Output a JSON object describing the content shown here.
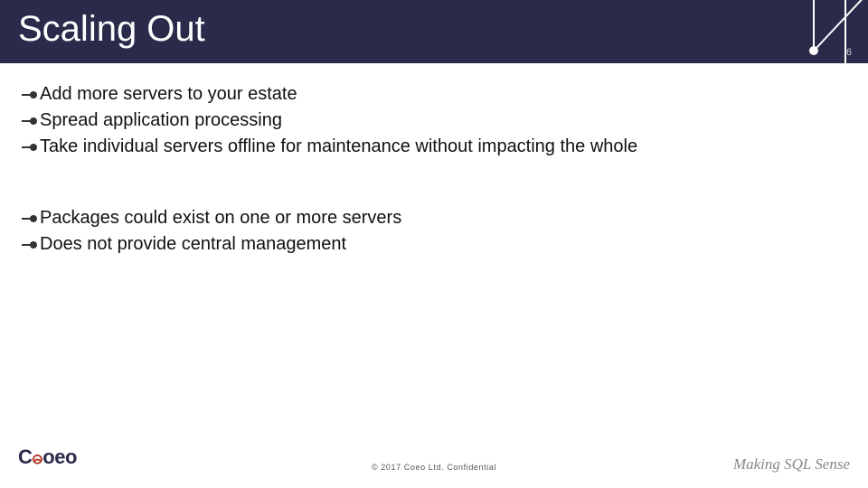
{
  "header": {
    "title": "Scaling Out",
    "page_number": "6"
  },
  "bullets_group1": [
    "Add more servers to your estate",
    "Spread application processing",
    "Take individual servers offline for maintenance without impacting the whole"
  ],
  "bullets_group2": [
    "Packages could exist on one or more servers",
    "Does not provide central management"
  ],
  "footer": {
    "logo_text_1": "C",
    "logo_text_2": "oeo",
    "copyright": "© 2017 Coeo Ltd. Confidential",
    "tagline": "Making SQL Sense"
  }
}
